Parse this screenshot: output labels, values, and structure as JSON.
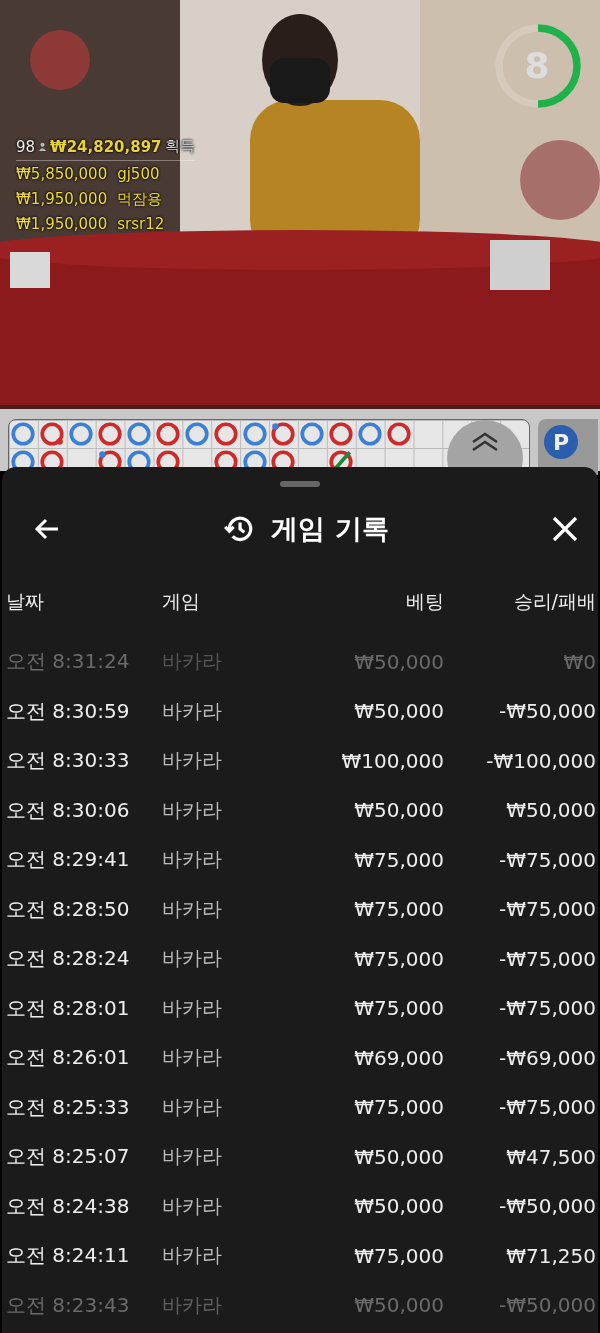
{
  "video": {
    "kind": "picture",
    "stats": {
      "count": "98",
      "total": "₩24,820,897",
      "label": "획득"
    },
    "winners": [
      {
        "amount": "₩5,850,000",
        "name": "gj500"
      },
      {
        "amount": "₩1,950,000",
        "name": "먹잠용"
      },
      {
        "amount": "₩1,950,000",
        "name": "srsr12"
      }
    ],
    "timer": {
      "value": "8",
      "level": 0.5
    }
  },
  "roadmap": {
    "columns": [
      {
        "top": {
          "color": "#3b7fd6"
        },
        "bottom": {
          "color": "#3b7fd6"
        }
      },
      {
        "top": {
          "color": "#cf2a2a",
          "dot": {
            "color": "#cf2a2a"
          }
        },
        "bottom": {
          "color": "#cf2a2a"
        }
      },
      {
        "top": {
          "color": "#3b7fd6"
        }
      },
      {
        "top": {
          "color": "#cf2a2a"
        },
        "bottom": {
          "color": "#cf2a2a",
          "dot": {
            "color": "#3b7fd6"
          }
        }
      },
      {
        "top": {
          "color": "#3b7fd6"
        },
        "bottom": {
          "color": "#3b7fd6"
        }
      },
      {
        "top": {
          "color": "#cf2a2a"
        },
        "bottom": {
          "color": "#cf2a2a"
        }
      },
      {
        "top": {
          "color": "#3b7fd6"
        }
      },
      {
        "top": {
          "color": "#cf2a2a"
        },
        "bottom": {
          "color": "#cf2a2a"
        }
      },
      {
        "top": {
          "color": "#3b7fd6"
        },
        "bottom": {
          "color": "#3b7fd6"
        }
      },
      {
        "top": {
          "color": "#cf2a2a",
          "dot": {
            "color": "#3b7fd6"
          }
        },
        "bottom": {
          "color": "#cf2a2a"
        }
      },
      {
        "top": {
          "color": "#3b7fd6"
        }
      },
      {
        "top": {
          "color": "#cf2a2a"
        },
        "bottom": {
          "color": "#cf2a2a",
          "slash": true
        }
      },
      {
        "top": {
          "color": "#3b7fd6"
        }
      },
      {
        "top": {
          "color": "#cf2a2a"
        }
      }
    ],
    "side_badge": "P"
  },
  "sheet": {
    "title": "게임 기록",
    "columns": [
      "날짜",
      "게임",
      "베팅",
      "승리/패배"
    ],
    "rows": [
      {
        "time": "오전 8:31:24",
        "game": "바카라",
        "bet": "₩50,000",
        "result": "₩0",
        "dimmed": true
      },
      {
        "time": "오전 8:30:59",
        "game": "바카라",
        "bet": "₩50,000",
        "result": "-₩50,000",
        "dimmed": false
      },
      {
        "time": "오전 8:30:33",
        "game": "바카라",
        "bet": "₩100,000",
        "result": "-₩100,000",
        "dimmed": false
      },
      {
        "time": "오전 8:30:06",
        "game": "바카라",
        "bet": "₩50,000",
        "result": "₩50,000",
        "dimmed": false
      },
      {
        "time": "오전 8:29:41",
        "game": "바카라",
        "bet": "₩75,000",
        "result": "-₩75,000",
        "dimmed": false
      },
      {
        "time": "오전 8:28:50",
        "game": "바카라",
        "bet": "₩75,000",
        "result": "-₩75,000",
        "dimmed": false
      },
      {
        "time": "오전 8:28:24",
        "game": "바카라",
        "bet": "₩75,000",
        "result": "-₩75,000",
        "dimmed": false
      },
      {
        "time": "오전 8:28:01",
        "game": "바카라",
        "bet": "₩75,000",
        "result": "-₩75,000",
        "dimmed": false
      },
      {
        "time": "오전 8:26:01",
        "game": "바카라",
        "bet": "₩69,000",
        "result": "-₩69,000",
        "dimmed": false
      },
      {
        "time": "오전 8:25:33",
        "game": "바카라",
        "bet": "₩75,000",
        "result": "-₩75,000",
        "dimmed": false
      },
      {
        "time": "오전 8:25:07",
        "game": "바카라",
        "bet": "₩50,000",
        "result": "₩47,500",
        "dimmed": false
      },
      {
        "time": "오전 8:24:38",
        "game": "바카라",
        "bet": "₩50,000",
        "result": "-₩50,000",
        "dimmed": false
      },
      {
        "time": "오전 8:24:11",
        "game": "바카라",
        "bet": "₩75,000",
        "result": "₩71,250",
        "dimmed": false
      },
      {
        "time": "오전 8:23:43",
        "game": "바카라",
        "bet": "₩50,000",
        "result": "-₩50,000",
        "dimmed": true
      }
    ]
  }
}
